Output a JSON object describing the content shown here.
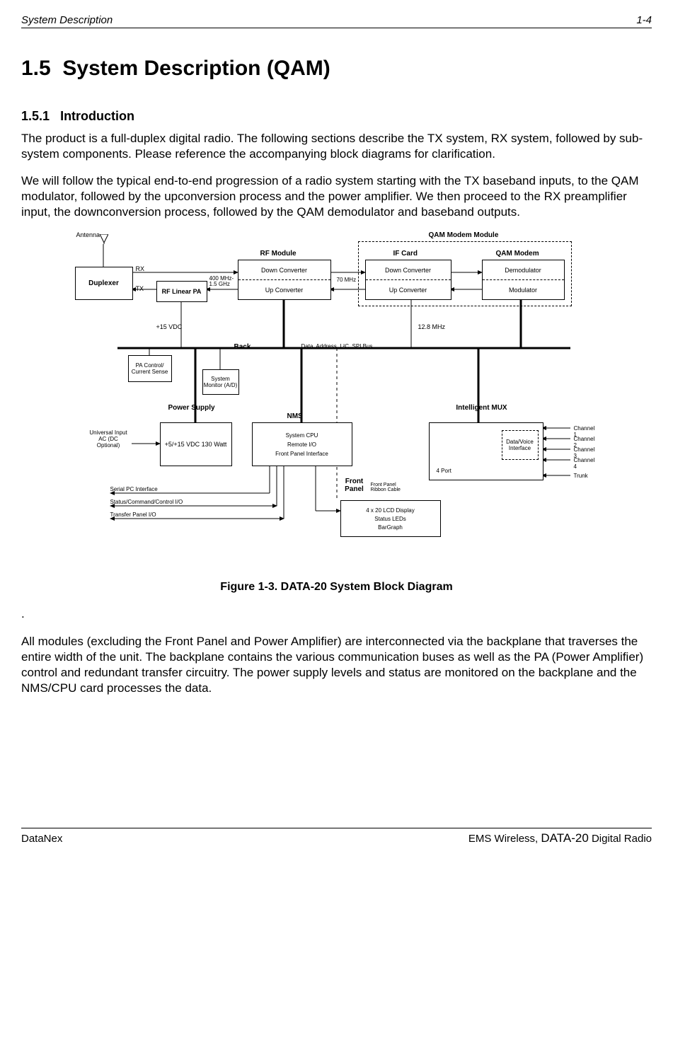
{
  "header": {
    "left": "System Description",
    "right": "1-4"
  },
  "section": {
    "number": "1.5",
    "title": "System Description (QAM)"
  },
  "subsection": {
    "number": "1.5.1",
    "title": "Introduction"
  },
  "para1": "The product is a full-duplex digital radio.  The following sections describe the TX system, RX system, followed by sub-system components.  Please reference the accompanying block diagrams for clarification.",
  "para2": "We will follow the typical end-to-end progression of a radio system starting with the TX baseband inputs, to the QAM modulator, followed by the upconversion process and the power amplifier.  We then proceed to the RX preamplifier input, the downconversion process, followed by the QAM demodulator and baseband outputs.",
  "diagram": {
    "antenna": "Antenna",
    "duplexer": "Duplexer",
    "rx": "RX",
    "tx": "TX",
    "rflinearpa": "RF Linear PA",
    "freq_rf": "400 MHz-1.5 GHz",
    "rf_module": "RF Module",
    "down_converter": "Down Converter",
    "up_converter": "Up Converter",
    "if_70": "70 MHz",
    "qam_modem_module": "QAM Modem Module",
    "if_card": "IF Card",
    "qam_modem": "QAM Modem",
    "demodulator": "Demodulator",
    "modulator": "Modulator",
    "plus15vdc": "+15 VDC",
    "pa_control": "PA Control/ Current Sense",
    "back": "Back",
    "bus": "Data, Address, I  ²C, SPI Bus",
    "khz128": "12.8 MHz",
    "sysmon": "System Monitor (A/D)",
    "power_supply": "Power Supply",
    "nms": "NMS",
    "intelligent_mux": "Intelligent MUX",
    "universal_input": "Universal Input AC (DC Optional)",
    "psu": "+5/+15 VDC 130 Watt",
    "nms_l1": "System CPU",
    "nms_l2": "Remote I/O",
    "nms_l3": "Front Panel Interface",
    "mux_4port": "4 Port",
    "mux_datavoice": "Data/Voice Interface",
    "ch1": "Channel 1",
    "ch2": "Channel 2",
    "ch3": "Channel 3",
    "ch4": "Channel 4",
    "trunk": "Trunk",
    "front_panel": "Front Panel",
    "fp_ribbon": "Front Panel Ribbon Cable",
    "fp_l1": "4 x 20 LCD Display",
    "fp_l2": "Status LEDs",
    "fp_l3": "BarGraph",
    "io1": "Serial PC Interface",
    "io2": "Status/Command/Control I/O",
    "io3": "Transfer Panel I/O"
  },
  "figure_caption": "Figure 1-3. DATA-20  System Block Diagram",
  "dot": ".",
  "para3": "All modules (excluding the Front Panel and Power Amplifier) are interconnected via the backplane that traverses the entire width of the unit.  The backplane contains the various communication buses as well as the PA (Power Amplifier) control and redundant transfer circuitry.  The power supply levels and status are monitored on the backplane and the NMS/CPU card processes the data.",
  "footer": {
    "left": "DataNex",
    "right_prefix": "EMS Wireless, ",
    "right_product": "DATA-20",
    "right_suffix": " Digital Radio"
  }
}
